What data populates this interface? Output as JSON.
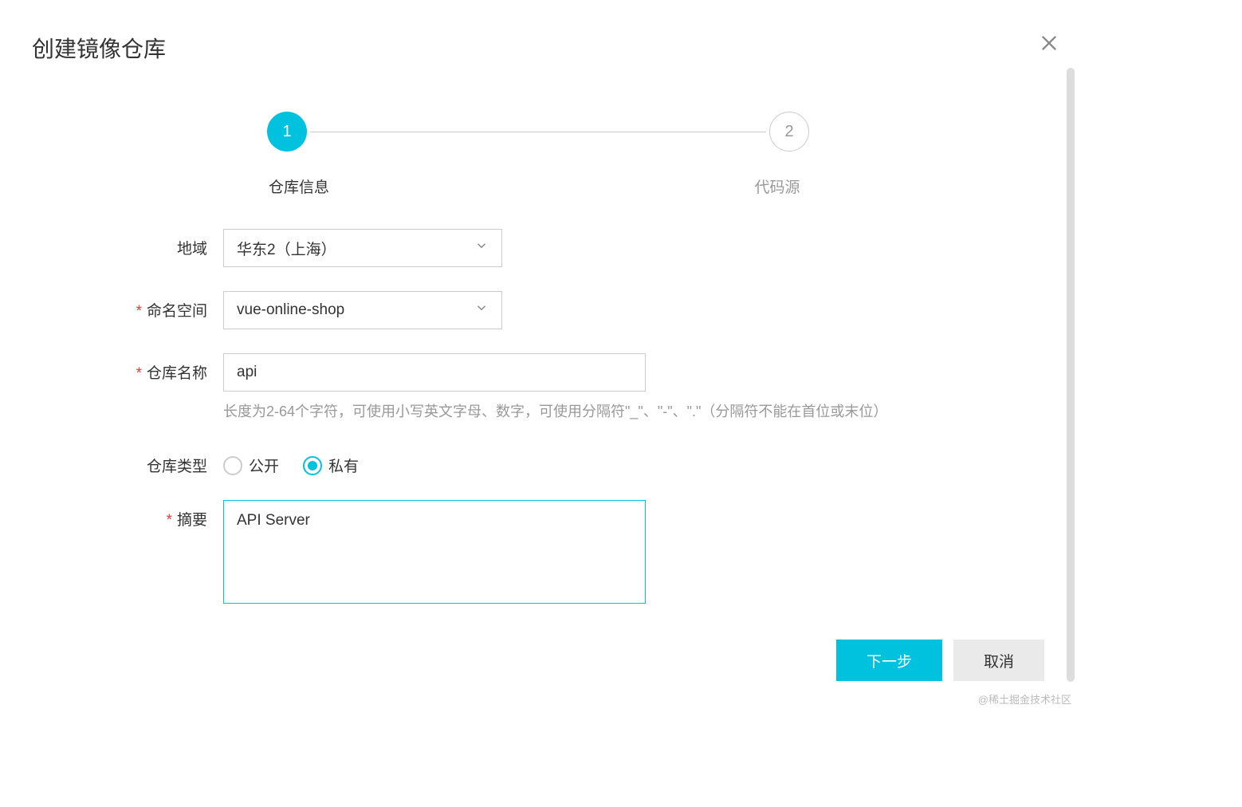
{
  "modal": {
    "title": "创建镜像仓库"
  },
  "steps": {
    "step1": {
      "number": "1",
      "label": "仓库信息"
    },
    "step2": {
      "number": "2",
      "label": "代码源"
    }
  },
  "form": {
    "region": {
      "label": "地域",
      "value": "华东2（上海）"
    },
    "namespace": {
      "label": "命名空间",
      "value": "vue-online-shop"
    },
    "repoName": {
      "label": "仓库名称",
      "value": "api",
      "help": "长度为2-64个字符，可使用小写英文字母、数字，可使用分隔符\"_\"、\"-\"、\".\"（分隔符不能在首位或末位）"
    },
    "repoType": {
      "label": "仓库类型",
      "options": {
        "public": "公开",
        "private": "私有"
      },
      "selected": "private"
    },
    "summary": {
      "label": "摘要",
      "value": "API Server"
    }
  },
  "footer": {
    "next": "下一步",
    "cancel": "取消"
  },
  "watermark": "@稀土掘金技术社区"
}
